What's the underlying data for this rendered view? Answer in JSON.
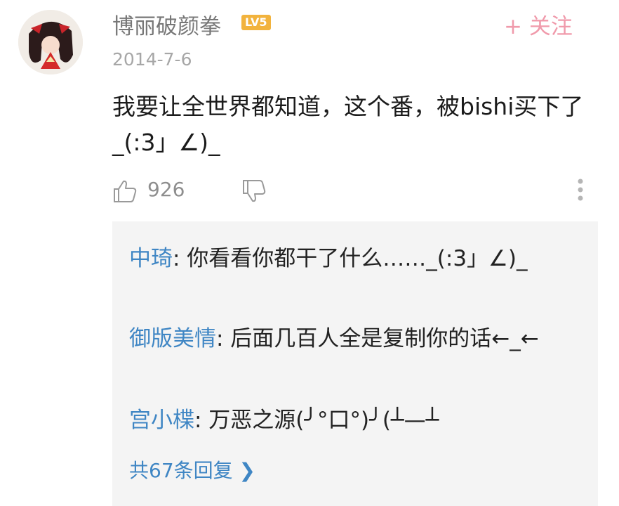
{
  "comment": {
    "username": "博丽破颜拳",
    "level": "LV5",
    "follow_label": "+ 关注",
    "date": "2014-7-6",
    "text": "我要让全世界都知道，这个番，被bishi买下了_(:3」∠)_",
    "like_count": "926"
  },
  "replies": [
    {
      "name": "中琦",
      "text": ": 你看看你都干了什么……_(:3」∠)_"
    },
    {
      "name": "御版美情",
      "text": ": 后面几百人全是复制你的话←_←"
    },
    {
      "name": "宫小楪",
      "text": ": 万恶之源(╯°口°)╯(┴—┴"
    }
  ],
  "more_replies": "共67条回复 ❯",
  "colors": {
    "accent_follow": "#f09aab",
    "reply_name": "#3f86c4",
    "level_badge": "#f2b33d"
  },
  "icons": [
    "avatar-image",
    "thumbs-up-icon",
    "thumbs-down-icon",
    "more-vertical-icon",
    "chevron-right-icon"
  ]
}
